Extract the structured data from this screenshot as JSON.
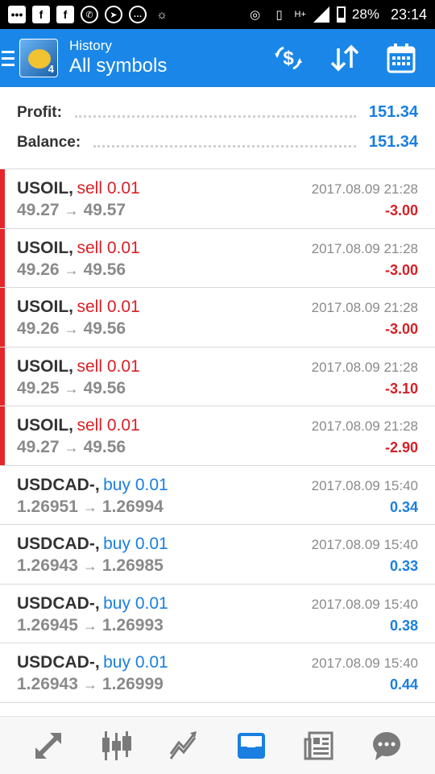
{
  "status_bar": {
    "icons": [
      "message-icon",
      "facebook-icon",
      "facebook-icon",
      "whatsapp-icon",
      "telegram-icon",
      "chat-icon",
      "bulb-icon",
      "hotspot-icon",
      "vibrate-icon",
      "signal-icon",
      "battery-icon"
    ],
    "network_label": "H+",
    "battery": "28%",
    "time": "23:14"
  },
  "header": {
    "subtitle": "History",
    "title": "All symbols",
    "actions": [
      "currency-exchange-icon",
      "sort-icon",
      "calendar-icon"
    ]
  },
  "summary": {
    "profit_label": "Profit:",
    "profit_value": "151.34",
    "balance_label": "Balance:",
    "balance_value": "151.34"
  },
  "trades": [
    {
      "symbol": "USOIL,",
      "type": "sell 0.01",
      "side": "sell",
      "time": "2017.08.09 21:28",
      "open": "49.27",
      "close": "49.57",
      "profit": "-3.00"
    },
    {
      "symbol": "USOIL,",
      "type": "sell 0.01",
      "side": "sell",
      "time": "2017.08.09 21:28",
      "open": "49.26",
      "close": "49.56",
      "profit": "-3.00"
    },
    {
      "symbol": "USOIL,",
      "type": "sell 0.01",
      "side": "sell",
      "time": "2017.08.09 21:28",
      "open": "49.26",
      "close": "49.56",
      "profit": "-3.00"
    },
    {
      "symbol": "USOIL,",
      "type": "sell 0.01",
      "side": "sell",
      "time": "2017.08.09 21:28",
      "open": "49.25",
      "close": "49.56",
      "profit": "-3.10"
    },
    {
      "symbol": "USOIL,",
      "type": "sell 0.01",
      "side": "sell",
      "time": "2017.08.09 21:28",
      "open": "49.27",
      "close": "49.56",
      "profit": "-2.90"
    },
    {
      "symbol": "USDCAD-,",
      "type": "buy 0.01",
      "side": "buy",
      "time": "2017.08.09 15:40",
      "open": "1.26951",
      "close": "1.26994",
      "profit": "0.34"
    },
    {
      "symbol": "USDCAD-,",
      "type": "buy 0.01",
      "side": "buy",
      "time": "2017.08.09 15:40",
      "open": "1.26943",
      "close": "1.26985",
      "profit": "0.33"
    },
    {
      "symbol": "USDCAD-,",
      "type": "buy 0.01",
      "side": "buy",
      "time": "2017.08.09 15:40",
      "open": "1.26945",
      "close": "1.26993",
      "profit": "0.38"
    },
    {
      "symbol": "USDCAD-,",
      "type": "buy 0.01",
      "side": "buy",
      "time": "2017.08.09 15:40",
      "open": "1.26943",
      "close": "1.26999",
      "profit": "0.44"
    }
  ],
  "bottom_nav": [
    "quotes-icon",
    "chart-icon",
    "trade-icon",
    "history-icon",
    "news-icon",
    "messages-icon"
  ],
  "colors": {
    "accent": "#1a87e8",
    "active_nav": "#1a7fe0",
    "sell": "#d81f26",
    "buy": "#1a7fe0"
  }
}
